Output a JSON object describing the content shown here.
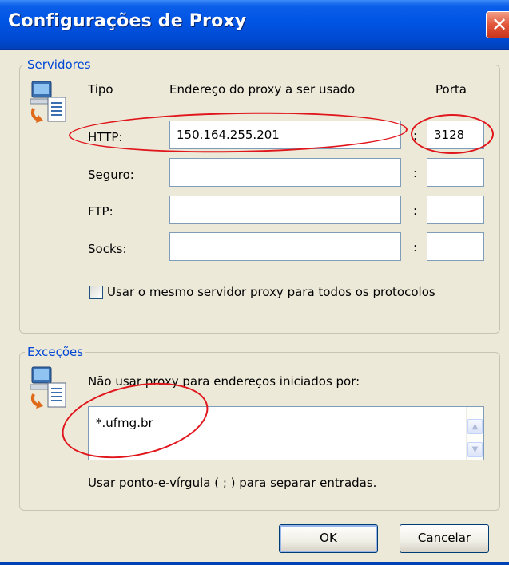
{
  "window": {
    "title": "Configurações de Proxy",
    "close_glyph": "✕"
  },
  "servers": {
    "legend": "Servidores",
    "col_type": "Tipo",
    "col_address": "Endereço do proxy a ser usado",
    "col_port": "Porta",
    "rows": [
      {
        "label": "HTTP:",
        "address": "150.164.255.201",
        "port": "3128"
      },
      {
        "label": "Seguro:",
        "address": "",
        "port": ""
      },
      {
        "label": "FTP:",
        "address": "",
        "port": ""
      },
      {
        "label": "Socks:",
        "address": "",
        "port": ""
      }
    ],
    "colon": ":",
    "same_proxy_label": "Usar o mesmo servidor proxy para todos os protocolos",
    "same_proxy_checked": false
  },
  "exceptions": {
    "legend": "Exceções",
    "description": "Não usar proxy para endereços iniciados por:",
    "value": "*.ufmg.br",
    "hint": "Usar ponto-e-vírgula ( ; ) para separar entradas."
  },
  "buttons": {
    "ok": "OK",
    "cancel": "Cancelar"
  },
  "colors": {
    "titlebar": "#0054e3",
    "legend_text": "#0046d5",
    "annotation": "#e0161c",
    "dialog_bg": "#ece9d8"
  },
  "icons": [
    "network-computer-icon",
    "close-icon",
    "scroll-up-icon",
    "scroll-down-icon"
  ]
}
